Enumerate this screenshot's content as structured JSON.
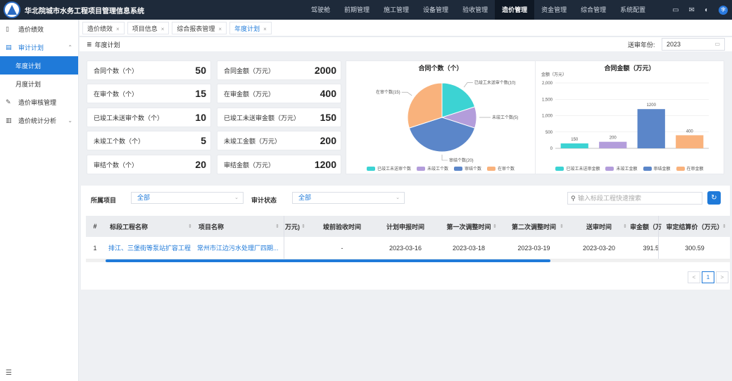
{
  "app": {
    "title": "华北院城市水务工程项目管理信息系统"
  },
  "topnav": [
    {
      "label": "驾驶舱"
    },
    {
      "label": "前期管理"
    },
    {
      "label": "施工管理"
    },
    {
      "label": "设备管理"
    },
    {
      "label": "验收管理"
    },
    {
      "label": "造价管理"
    },
    {
      "label": "资金管理"
    },
    {
      "label": "综合管理"
    },
    {
      "label": "系统配置"
    }
  ],
  "topnav_active": "造价管理",
  "avatar_text": "李",
  "sidebar": {
    "items": [
      {
        "label": "造价绩效"
      },
      {
        "label": "审计计划"
      },
      {
        "label": "年度计划"
      },
      {
        "label": "月度计划"
      },
      {
        "label": "造价审核管理"
      },
      {
        "label": "造价统计分析"
      }
    ]
  },
  "tabs": [
    {
      "label": "造价绩效"
    },
    {
      "label": "项目信息"
    },
    {
      "label": "综合报表管理"
    },
    {
      "label": "年度计划"
    }
  ],
  "page": {
    "title": "年度计划",
    "year_label": "送审年份:",
    "year_value": "2023"
  },
  "stats": [
    {
      "label": "合同个数（个）",
      "value": "50"
    },
    {
      "label": "合同金额（万元）",
      "value": "2000"
    },
    {
      "label": "在审个数（个）",
      "value": "15"
    },
    {
      "label": "在审金额（万元）",
      "value": "400"
    },
    {
      "label": "已竣工未送审个数（个）",
      "value": "10"
    },
    {
      "label": "已竣工未送审金额（万元）",
      "value": "150"
    },
    {
      "label": "未竣工个数（个）",
      "value": "5"
    },
    {
      "label": "未竣工金额（万元）",
      "value": "200"
    },
    {
      "label": "审结个数（个）",
      "value": "20"
    },
    {
      "label": "审结金额（万元）",
      "value": "1200"
    }
  ],
  "chart_data": [
    {
      "type": "pie",
      "title": "合同个数（个）",
      "categories": [
        "已竣工未送审个数",
        "未竣工个数",
        "审结个数",
        "在审个数"
      ],
      "values": [
        10,
        5,
        20,
        15
      ],
      "slice_labels": [
        "已竣工未送审个数(10)",
        "未竣工个数(5)",
        "审结个数(20)",
        "在审个数(15)"
      ],
      "colors": [
        "#3cd3d3",
        "#b39ddb",
        "#5b86c9",
        "#f9b27c"
      ],
      "legend": "bottom"
    },
    {
      "type": "bar",
      "title": "合同金额（万元）",
      "ylabel": "金额（万元）",
      "categories": [
        "已竣工未送审金额",
        "未竣工金额",
        "审结金额",
        "在审金额"
      ],
      "values": [
        150,
        200,
        1200,
        400
      ],
      "colors": [
        "#3cd3d3",
        "#b39ddb",
        "#5b86c9",
        "#f9b27c"
      ],
      "ylim": [
        0,
        2000
      ],
      "yticks": [
        "0",
        "500",
        "1,000",
        "1,500",
        "2,000"
      ],
      "grid": true,
      "legend": "bottom"
    }
  ],
  "filters": {
    "project_label": "所属项目",
    "project_value": "全部",
    "status_label": "审计状态",
    "status_value": "全部",
    "search_placeholder": "输入标段工程快速搜索"
  },
  "table": {
    "headers": [
      "#",
      "标段工程名称",
      "项目名称",
      "万元)",
      "竣前验收时间",
      "计划申报时间",
      "第一次调整时间",
      "第二次调整时间",
      "送审时间",
      "送审金额（万",
      "审定结算价（万元）"
    ],
    "rows": [
      [
        "1",
        "排江、三堡街等泵站扩容工程",
        "常州市江边污水处理厂四期...",
        "",
        "-",
        "2023-03-16",
        "2023-03-18",
        "2023-03-19",
        "2023-03-20",
        "391.5",
        "300.59"
      ]
    ]
  },
  "pager": {
    "prev": "<",
    "page": "1",
    "next": ">"
  }
}
